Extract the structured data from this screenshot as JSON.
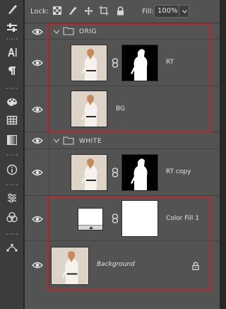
{
  "options_bar": {
    "lock_label": "Lock:",
    "fill_label": "Fill:",
    "fill_value": "100%",
    "lock_icons": [
      "lock-transparent-pixels-icon",
      "lock-image-pixels-icon",
      "lock-position-icon",
      "lock-artboard-icon",
      "lock-all-icon"
    ]
  },
  "tools": [
    "brush-tool-icon",
    "adjust-brush-icon",
    "character-panel-icon",
    "paragraph-panel-icon",
    "swatches-icon",
    "table-icon",
    "gradient-icon",
    "info-icon",
    "adjustments-icon",
    "channels-icon",
    "paths-icon"
  ],
  "layers": {
    "group_orig": {
      "name": "ORIG",
      "collapse_state": "expanded"
    },
    "rt": {
      "name": "RT"
    },
    "bg": {
      "name": "BG"
    },
    "group_white": {
      "name": "WHITE",
      "collapse_state": "expanded"
    },
    "rt_copy": {
      "name": "RT copy"
    },
    "color_fill": {
      "name": "Color Fill 1"
    },
    "background": {
      "name": "Background",
      "locked": true
    }
  },
  "colors": {
    "panel": "#535353",
    "toolbar": "#3c3c3c",
    "highlight": "#c0262a"
  }
}
